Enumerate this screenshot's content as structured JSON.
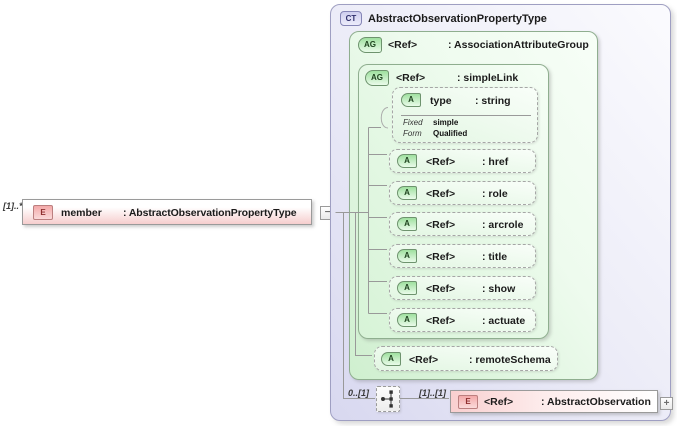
{
  "colors": {
    "element_fill": "#f6cdcd",
    "group_fill": "#cfefcf",
    "complex_type_fill": "#d8d8f0",
    "connector": "#999999"
  },
  "occurs": {
    "member": "[1]..*",
    "sequence": "0..[1]",
    "observation": "[1]..[1]"
  },
  "member": {
    "icon": "E",
    "name": "member",
    "type": ": AbstractObservationPropertyType",
    "collapse": "−"
  },
  "complex_type": {
    "icon": "CT",
    "title": "AbstractObservationPropertyType",
    "association_attribute_group": {
      "icon": "AG",
      "ref": "<Ref>",
      "name": ": AssociationAttributeGroup",
      "simple_link": {
        "icon": "AG",
        "ref": "<Ref>",
        "name": ": simpleLink",
        "type_attribute": {
          "icon": "A",
          "name": "type",
          "type": ": string",
          "facets": [
            {
              "label": "Fixed",
              "value": "simple"
            },
            {
              "label": "Form",
              "value": "Qualified"
            }
          ]
        },
        "attributes": [
          {
            "icon": "A",
            "ref": "<Ref>",
            "name": ": href"
          },
          {
            "icon": "A",
            "ref": "<Ref>",
            "name": ": role"
          },
          {
            "icon": "A",
            "ref": "<Ref>",
            "name": ": arcrole"
          },
          {
            "icon": "A",
            "ref": "<Ref>",
            "name": ": title"
          },
          {
            "icon": "A",
            "ref": "<Ref>",
            "name": ": show"
          },
          {
            "icon": "A",
            "ref": "<Ref>",
            "name": ": actuate"
          }
        ]
      },
      "remote_schema": {
        "icon": "A",
        "ref": "<Ref>",
        "name": ": remoteSchema"
      }
    },
    "sequence_element": {
      "icon": "E",
      "ref": "<Ref>",
      "name": ": AbstractObservation",
      "expand": "+"
    }
  }
}
